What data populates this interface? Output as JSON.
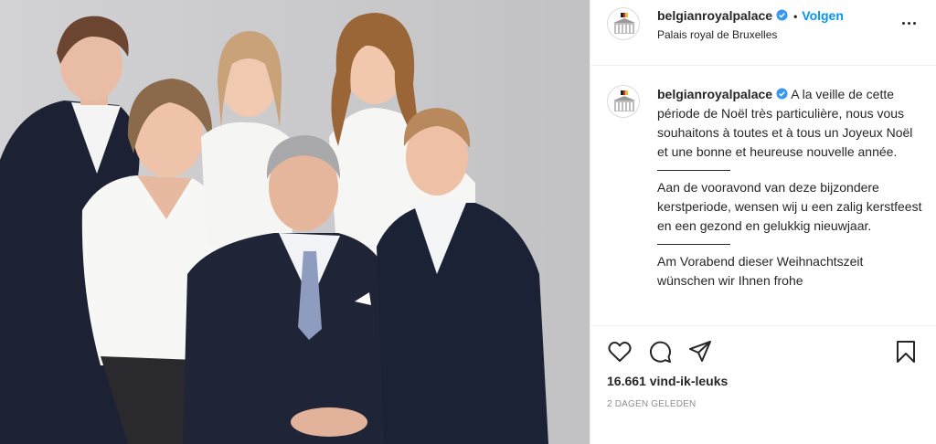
{
  "post": {
    "photo_alt": "Belgian royal family portrait",
    "header": {
      "username": "belgianroyalpalace",
      "separator": "•",
      "follow_label": "Volgen",
      "location": "Palais royal de Bruxelles"
    },
    "caption": {
      "username": "belgianroyalpalace",
      "fr": "A la veille de cette période de Noël très particulière, nous vous souhaitons à toutes et à tous un Joyeux Noël et une bonne et heureuse nouvelle année.",
      "nl": "Aan de vooravond van deze bijzondere kerstperiode, wensen wij u een zalig kerstfeest en een gezond en gelukkig nieuwjaar.",
      "de": "Am Vorabend dieser Weihnachtszeit wünschen wir Ihnen frohe"
    },
    "likes": "16.661 vind-ik-leuks",
    "date": "2 DAGEN GELEDEN"
  },
  "icons": {
    "more": "more-options-icon",
    "like": "heart-icon",
    "comment": "comment-icon",
    "share": "share-icon",
    "save": "bookmark-icon",
    "verified": "verified-badge-icon",
    "avatar": "palace-logo-icon"
  },
  "colors": {
    "follow": "#0095f6",
    "verified": "#3897f0",
    "text": "#262626",
    "muted": "#8e8e8e",
    "border": "#efefef",
    "photo_background": "#cbcbcd"
  }
}
